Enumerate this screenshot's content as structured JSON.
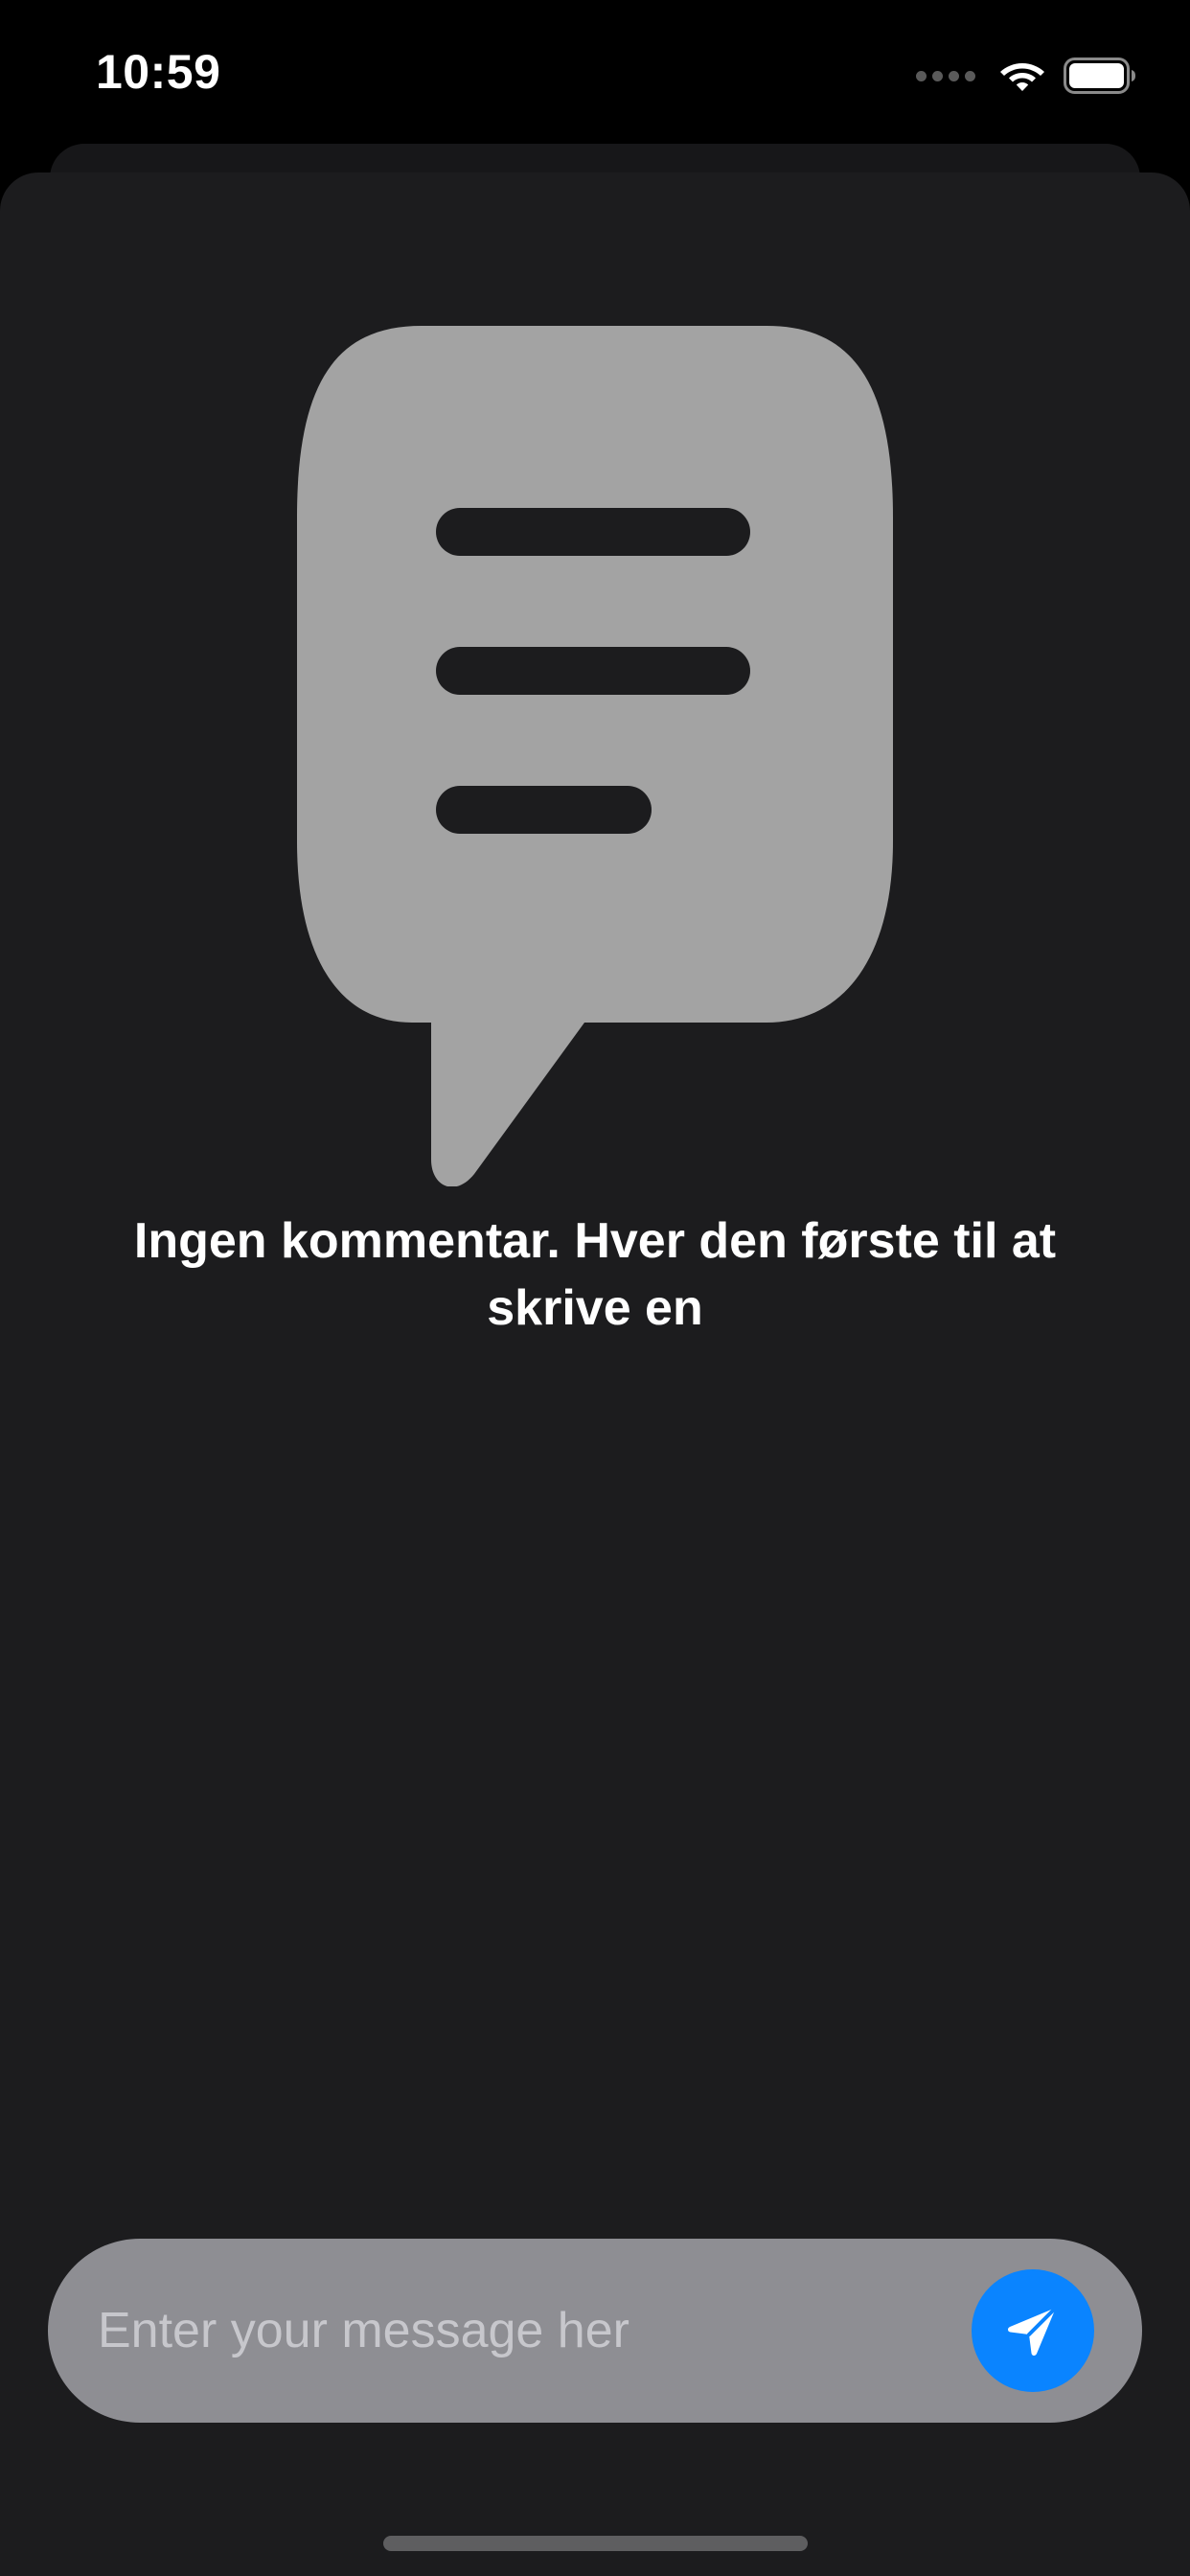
{
  "status_bar": {
    "time": "10:59"
  },
  "empty_state": {
    "icon": "message-bubble-icon",
    "message": "Ingen kommentar. Hver den første til at skrive en"
  },
  "composer": {
    "value": "",
    "placeholder": "Enter your message her",
    "send_icon": "paper-plane-icon"
  },
  "colors": {
    "background": "#1c1c1e",
    "icon_gray": "#a3a3a3",
    "input_bg": "#8e8e93",
    "accent": "#0a84ff"
  }
}
